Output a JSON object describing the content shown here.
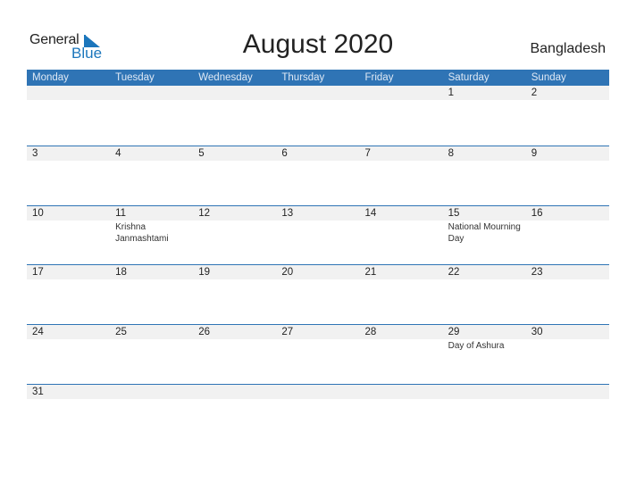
{
  "logo": {
    "general": "General",
    "blue": "Blue"
  },
  "title": "August 2020",
  "country": "Bangladesh",
  "days": [
    "Monday",
    "Tuesday",
    "Wednesday",
    "Thursday",
    "Friday",
    "Saturday",
    "Sunday"
  ],
  "weeks": [
    [
      {
        "d": ""
      },
      {
        "d": ""
      },
      {
        "d": ""
      },
      {
        "d": ""
      },
      {
        "d": ""
      },
      {
        "d": "1"
      },
      {
        "d": "2"
      }
    ],
    [
      {
        "d": "3"
      },
      {
        "d": "4"
      },
      {
        "d": "5"
      },
      {
        "d": "6"
      },
      {
        "d": "7"
      },
      {
        "d": "8"
      },
      {
        "d": "9"
      }
    ],
    [
      {
        "d": "10"
      },
      {
        "d": "11",
        "e": "Krishna Janmashtami"
      },
      {
        "d": "12"
      },
      {
        "d": "13"
      },
      {
        "d": "14"
      },
      {
        "d": "15",
        "e": "National Mourning Day"
      },
      {
        "d": "16"
      }
    ],
    [
      {
        "d": "17"
      },
      {
        "d": "18"
      },
      {
        "d": "19"
      },
      {
        "d": "20"
      },
      {
        "d": "21"
      },
      {
        "d": "22"
      },
      {
        "d": "23"
      }
    ],
    [
      {
        "d": "24"
      },
      {
        "d": "25"
      },
      {
        "d": "26"
      },
      {
        "d": "27"
      },
      {
        "d": "28"
      },
      {
        "d": "29",
        "e": "Day of Ashura"
      },
      {
        "d": "30"
      }
    ],
    [
      {
        "d": "31"
      },
      {
        "d": ""
      },
      {
        "d": ""
      },
      {
        "d": ""
      },
      {
        "d": ""
      },
      {
        "d": ""
      },
      {
        "d": ""
      }
    ]
  ],
  "colors": {
    "header": "#2f74b5",
    "brand_blue": "#1b76bc",
    "strip": "#f1f1f1"
  }
}
